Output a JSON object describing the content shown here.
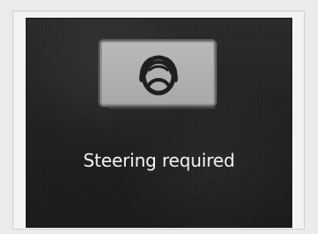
{
  "screen": {
    "status_text": "Steering required",
    "icon_name": "steering-wheel-hands-icon"
  }
}
